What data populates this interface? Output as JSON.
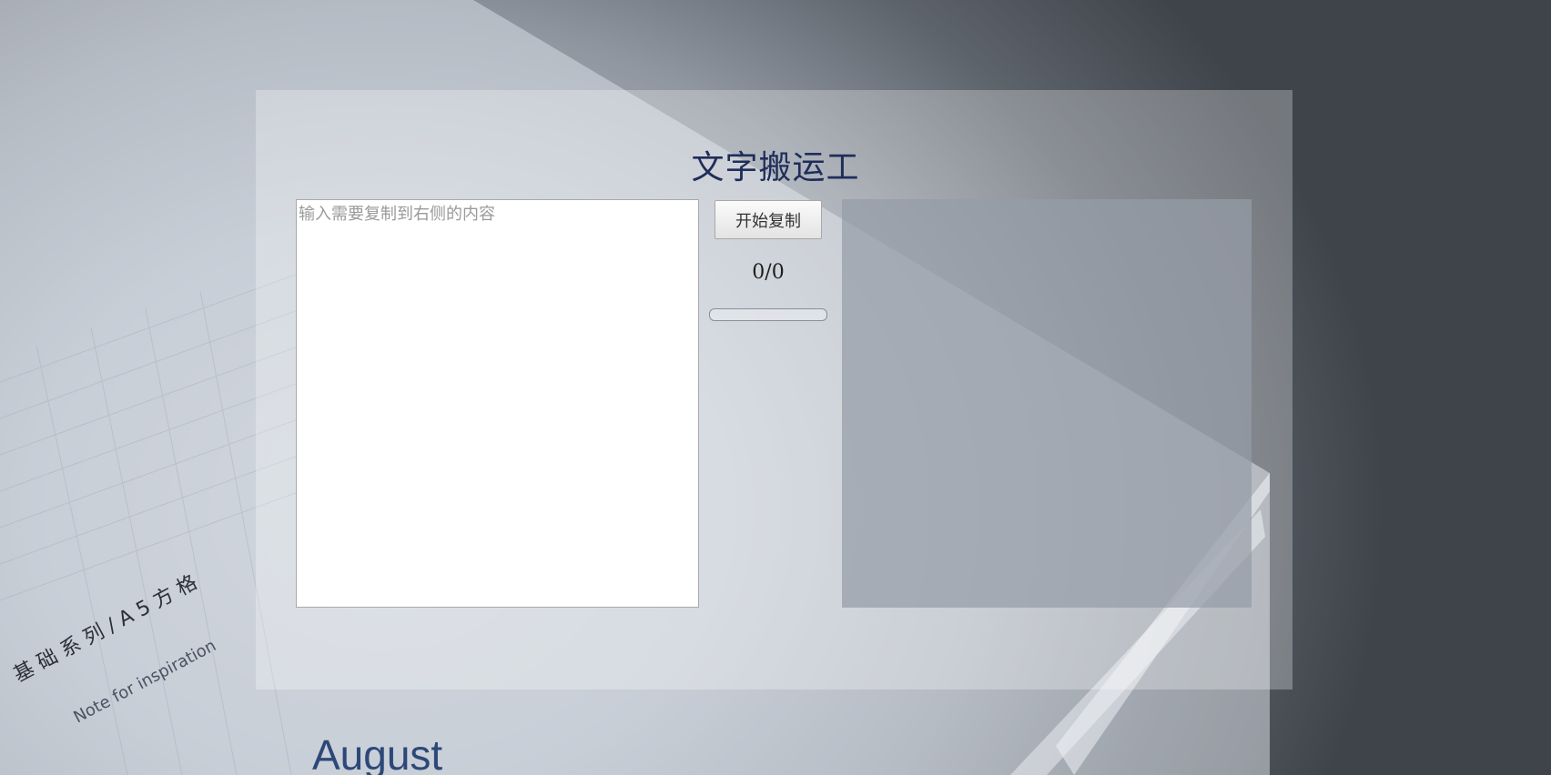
{
  "title": "文字搬运工",
  "source_input": {
    "placeholder": "输入需要复制到右侧的内容",
    "value": ""
  },
  "copy_button": {
    "label": "开始复制"
  },
  "counter": {
    "text": "0/0",
    "done": 0,
    "total": 0
  },
  "progress": {
    "fraction": 0
  },
  "background": {
    "notebook_text_1": "基 础 系 列 / A 5 方 格",
    "notebook_text_2": "Note for inspiration",
    "notebook_text_3": "August"
  },
  "colors": {
    "title": "#1f2d5a",
    "panel": "rgba(255,255,255,0.28)",
    "output_panel": "rgba(150,156,168,0.72)"
  }
}
